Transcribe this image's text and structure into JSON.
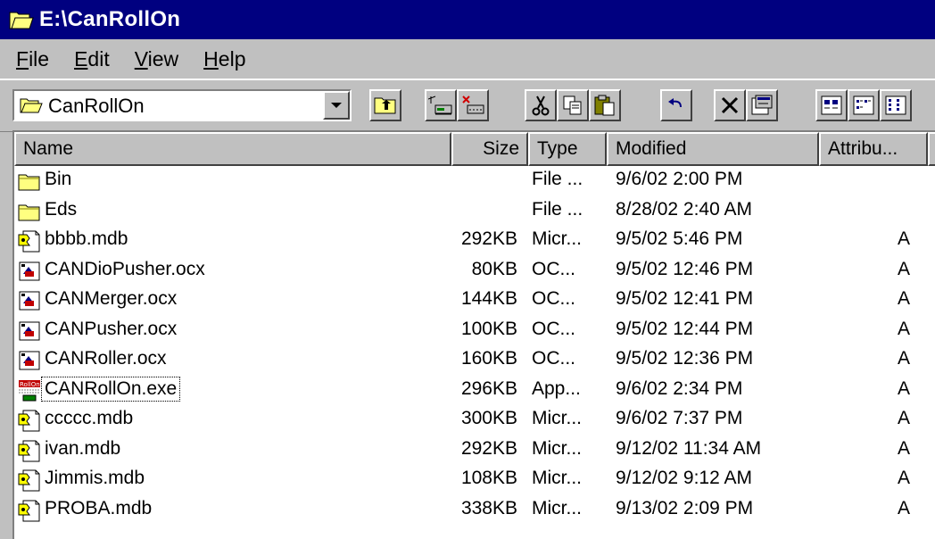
{
  "window": {
    "title": "E:\\CanRollOn"
  },
  "menu": [
    {
      "id": "file",
      "label_ul": "F",
      "label_rest": "ile"
    },
    {
      "id": "edit",
      "label_ul": "E",
      "label_rest": "dit"
    },
    {
      "id": "view",
      "label_ul": "V",
      "label_rest": "iew"
    },
    {
      "id": "help",
      "label_ul": "H",
      "label_rest": "elp"
    }
  ],
  "toolbar": {
    "address_value": "CanRollOn",
    "buttons": [
      "up-one-level",
      "map-network-drive",
      "disconnect-network-drive",
      "cut",
      "copy",
      "paste",
      "undo",
      "delete",
      "properties",
      "large-icons",
      "small-icons",
      "list"
    ]
  },
  "columns": {
    "name": "Name",
    "size": "Size",
    "type": "Type",
    "modified": "Modified",
    "attributes": "Attribu..."
  },
  "files": [
    {
      "icon": "folder-icon",
      "name": "Bin",
      "size": "",
      "type": "File ...",
      "modified": "9/6/02 2:00 PM",
      "attr": ""
    },
    {
      "icon": "folder-icon",
      "name": "Eds",
      "size": "",
      "type": "File ...",
      "modified": "8/28/02 2:40 AM",
      "attr": ""
    },
    {
      "icon": "access-db-icon",
      "name": "bbbb.mdb",
      "size": "292KB",
      "type": "Micr...",
      "modified": "9/5/02 5:46 PM",
      "attr": "A"
    },
    {
      "icon": "ocx-icon",
      "name": "CANDioPusher.ocx",
      "size": "80KB",
      "type": "OC...",
      "modified": "9/5/02 12:46 PM",
      "attr": "A"
    },
    {
      "icon": "ocx-icon",
      "name": "CANMerger.ocx",
      "size": "144KB",
      "type": "OC...",
      "modified": "9/5/02 12:41 PM",
      "attr": "A"
    },
    {
      "icon": "ocx-icon",
      "name": "CANPusher.ocx",
      "size": "100KB",
      "type": "OC...",
      "modified": "9/5/02 12:44 PM",
      "attr": "A"
    },
    {
      "icon": "ocx-icon",
      "name": "CANRoller.ocx",
      "size": "160KB",
      "type": "OC...",
      "modified": "9/5/02 12:36 PM",
      "attr": "A"
    },
    {
      "icon": "app-exe-icon",
      "name": "CANRollOn.exe",
      "size": "296KB",
      "type": "App...",
      "modified": "9/6/02 2:34 PM",
      "attr": "A",
      "focused": true
    },
    {
      "icon": "access-db-icon",
      "name": "ccccc.mdb",
      "size": "300KB",
      "type": "Micr...",
      "modified": "9/6/02 7:37 PM",
      "attr": "A"
    },
    {
      "icon": "access-db-icon",
      "name": "ivan.mdb",
      "size": "292KB",
      "type": "Micr...",
      "modified": "9/12/02 11:34 AM",
      "attr": "A"
    },
    {
      "icon": "access-db-icon",
      "name": "Jimmis.mdb",
      "size": "108KB",
      "type": "Micr...",
      "modified": "9/12/02 9:12 AM",
      "attr": "A"
    },
    {
      "icon": "access-db-icon",
      "name": "PROBA.mdb",
      "size": "338KB",
      "type": "Micr...",
      "modified": "9/13/02 2:09 PM",
      "attr": "A"
    }
  ],
  "colors": {
    "title_bar": "#000080",
    "face": "#c0c0c0",
    "folder": "#ffff80"
  }
}
